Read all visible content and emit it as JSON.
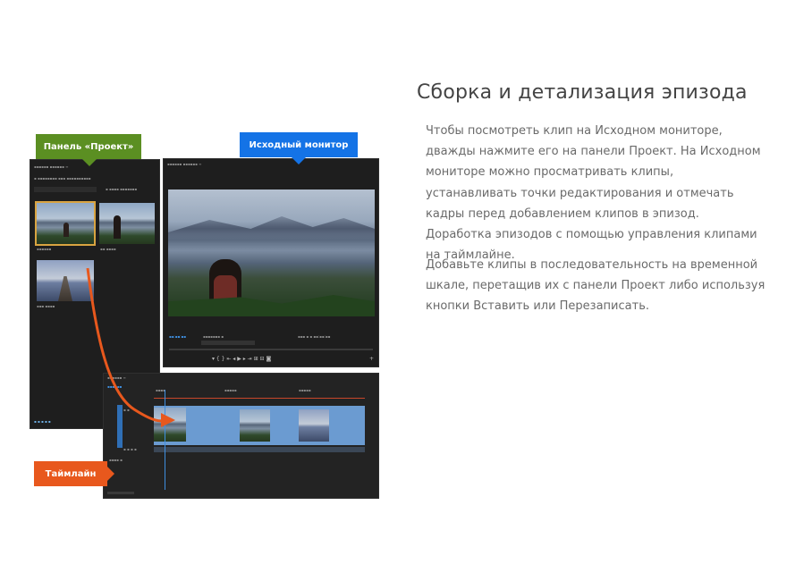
{
  "labels": {
    "project_panel": "Панель «Проект»",
    "source_monitor": "Исходный монитор",
    "timeline": "Таймлайн"
  },
  "heading": "Сборка и детализация эпизода",
  "paragraph1": "Чтобы посмотреть клип на Исходном мониторе, дважды нажмите его на панели Проект. На Исходном мониторе можно просматривать клипы, устанавливать точки редактирования и отмечать кадры перед добавлением клипов в эпизод. Доработка эпизодов с помощью управления клипами на таймлайне.",
  "paragraph2": "Добавьте клипы в последовательность на временной шкале, перетащив их с панели Проект либо используя кнопки Вставить или Перезаписать.",
  "colors": {
    "project_callout": "#5b8f22",
    "source_callout": "#1473e6",
    "timeline_callout": "#e8581d",
    "drag_arrow": "#e8581d",
    "clip": "#6b9bd1"
  }
}
